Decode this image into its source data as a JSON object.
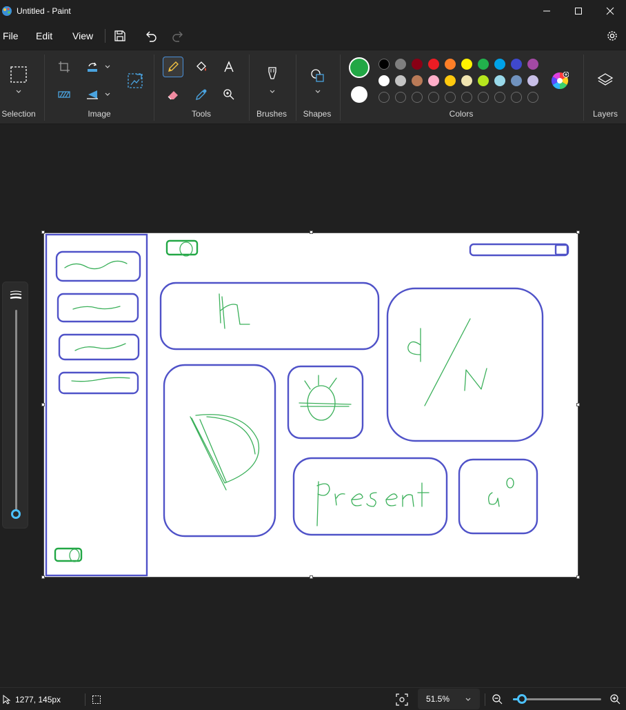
{
  "window": {
    "title": "Untitled - Paint"
  },
  "menu": {
    "file": "File",
    "edit": "Edit",
    "view": "View"
  },
  "ribbon": {
    "groups": {
      "selection": "Selection",
      "image": "Image",
      "tools": "Tools",
      "brushes": "Brushes",
      "shapes": "Shapes",
      "colors": "Colors",
      "layers": "Layers"
    },
    "active_tool": "pencil",
    "primary_color": "#22a745",
    "secondary_color": "#ffffff",
    "palette_row1": [
      "#000000",
      "#7f7f7f",
      "#880015",
      "#ed1c24",
      "#ff7f27",
      "#fff200",
      "#22b14c",
      "#00a2e8",
      "#3f48cc",
      "#a349a4"
    ],
    "palette_row2": [
      "#ffffff",
      "#c3c3c3",
      "#b97a57",
      "#ffaec9",
      "#ffc90e",
      "#efe4b0",
      "#b5e61d",
      "#99d9ea",
      "#7092be",
      "#c8bfe7"
    ],
    "palette_row3_empty_count": 10
  },
  "canvas": {
    "sketch_words": [
      "present",
      "d/N",
      "hi"
    ]
  },
  "status": {
    "cursor_position": "1277, 145px",
    "zoom": "51.5%",
    "zoom_level": 0.1
  },
  "colors": {
    "sketch_blue": "#4f52c8",
    "sketch_green": "#3bb05a",
    "accent": "#4cc2ff"
  }
}
